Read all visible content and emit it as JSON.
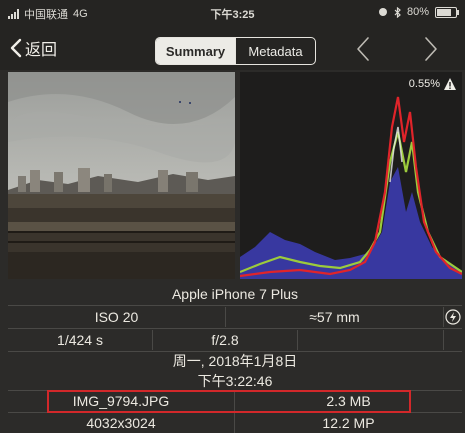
{
  "status_bar": {
    "carrier": "中国联通",
    "network": "4G",
    "time": "下午3:25",
    "battery_percent": "80%",
    "battery_level": 0.8
  },
  "nav": {
    "back_label": "返回",
    "tabs": [
      {
        "label": "Summary",
        "active": true
      },
      {
        "label": "Metadata",
        "active": false
      }
    ]
  },
  "histogram": {
    "clip_label": "0.55%"
  },
  "metadata": {
    "camera": "Apple iPhone 7 Plus",
    "iso": "ISO 20",
    "focal_length": "≈57 mm",
    "shutter": "1/424 s",
    "aperture": "f/2.8",
    "date": "周一, 2018年1月8日",
    "time": "下午3:22:46",
    "filename": "IMG_9794.JPG",
    "filesize": "2.3 MB",
    "dimensions": "4032x3024",
    "megapixels": "12.2 MP"
  },
  "colors": {
    "accent": "#d2282a",
    "histogram_red": "#e0242a",
    "histogram_green": "#9ccb3c",
    "histogram_blue": "#3a3aa8"
  }
}
